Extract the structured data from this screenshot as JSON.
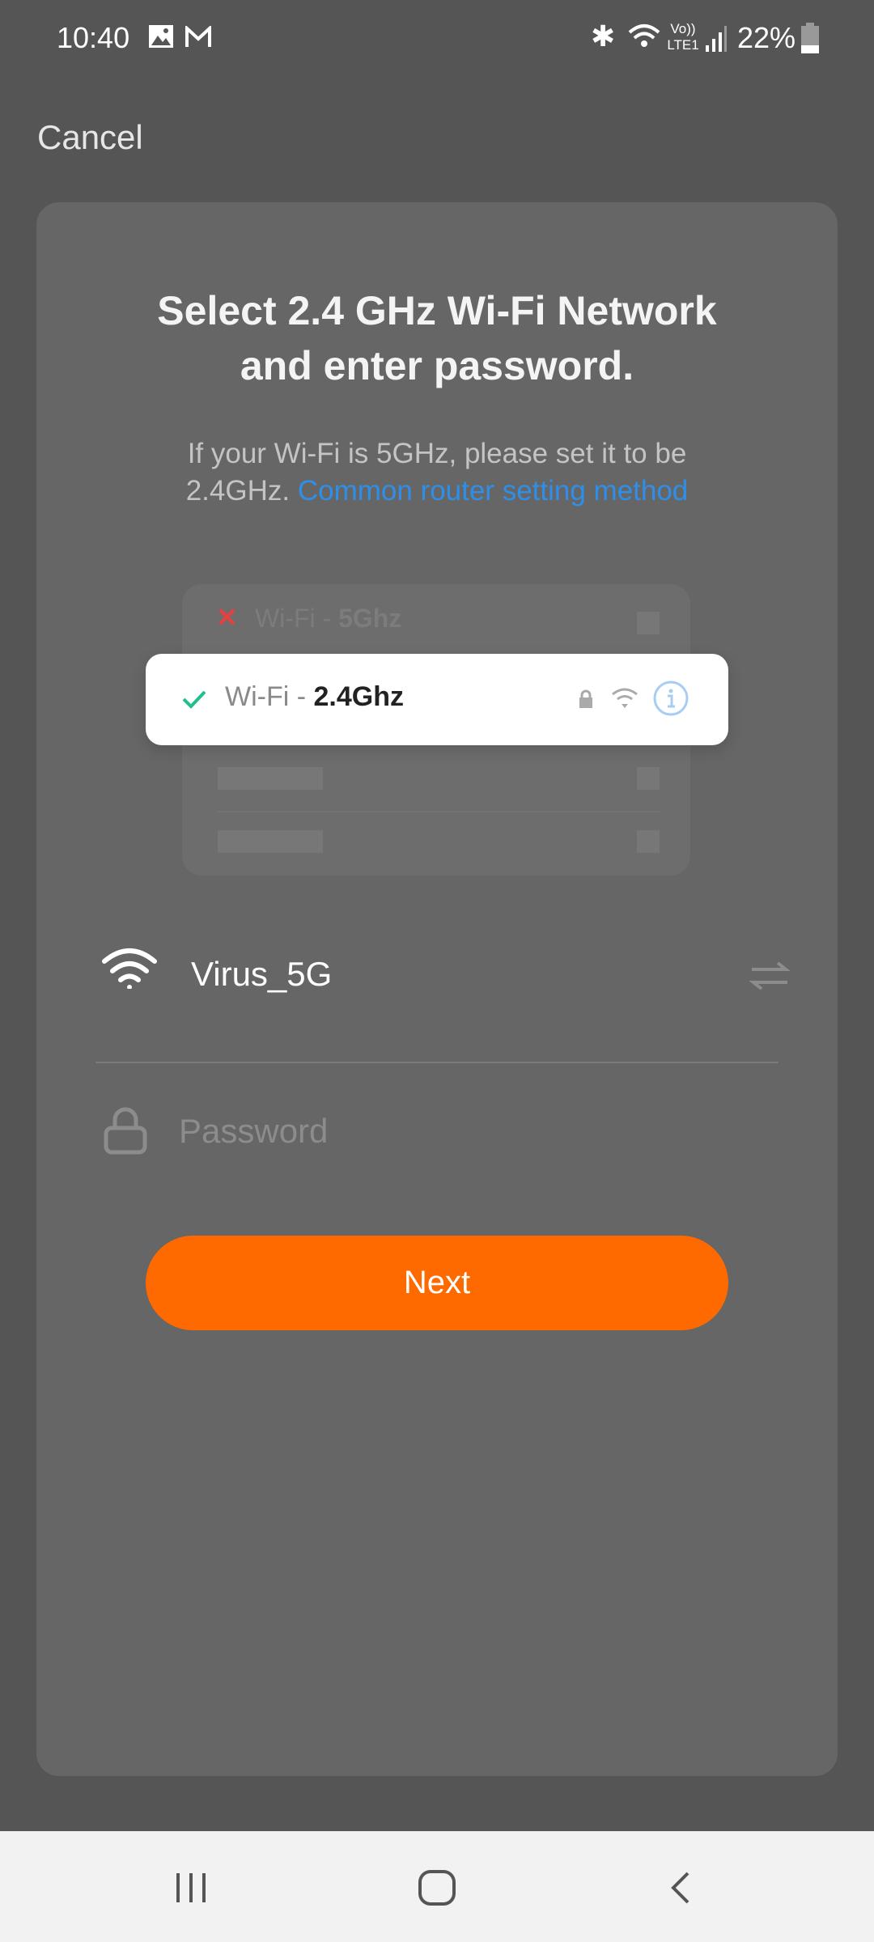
{
  "status_bar": {
    "time": "10:40",
    "network_label": "Vo)) LTE1",
    "battery": "22%"
  },
  "header": {
    "cancel_label": "Cancel"
  },
  "card": {
    "title_line1": "Select 2.4 GHz Wi-Fi Network",
    "title_line2": "and enter password.",
    "subtitle_line1": "If your Wi-Fi is 5GHz, please set it to be",
    "subtitle_prefix": "2.4GHz.",
    "subtitle_link": "Common router setting method",
    "illustration": {
      "bad_prefix": "Wi-Fi - ",
      "bad_band": "5Ghz",
      "good_prefix": "Wi-Fi - ",
      "good_band": "2.4Ghz"
    },
    "ssid_value": "Virus_5G",
    "password_placeholder": "Password",
    "next_label": "Next"
  },
  "colors": {
    "accent": "#ff6a00",
    "link": "#2f8fe8",
    "check": "#1fbf8f",
    "cross": "#e84040"
  }
}
